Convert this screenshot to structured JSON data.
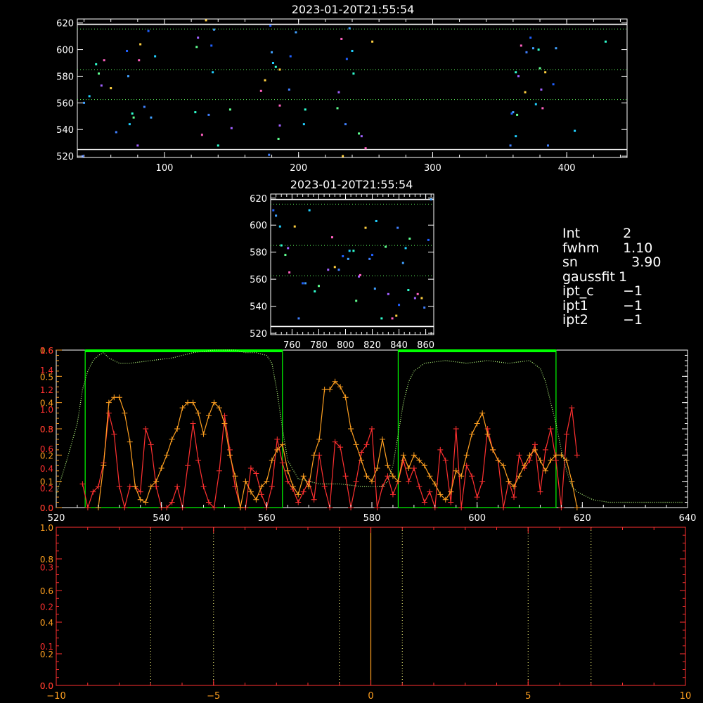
{
  "chart_data": [
    {
      "type": "scatter",
      "title": "2023-01-20T21:55:54",
      "xlim": [
        35,
        445
      ],
      "ylim": [
        519,
        623
      ],
      "xticks": [
        100,
        200,
        300,
        400
      ],
      "yticks": [
        520,
        540,
        560,
        580,
        600,
        620
      ],
      "hlines_solid": [
        525,
        619
      ],
      "hlines_dotted": [
        562.5,
        585,
        615.5
      ],
      "points": [
        [
          39,
          520
        ],
        [
          40,
          560
        ],
        [
          44,
          565
        ],
        [
          49,
          589
        ],
        [
          51,
          582
        ],
        [
          53,
          573
        ],
        [
          55,
          592
        ],
        [
          60,
          571
        ],
        [
          64,
          538
        ],
        [
          72,
          599
        ],
        [
          73,
          580
        ],
        [
          74,
          544
        ],
        [
          76,
          552
        ],
        [
          77,
          549
        ],
        [
          80,
          528
        ],
        [
          81,
          592
        ],
        [
          82,
          604
        ],
        [
          85,
          557
        ],
        [
          88,
          614
        ],
        [
          90,
          549
        ],
        [
          93,
          595
        ],
        [
          123,
          553
        ],
        [
          124,
          602
        ],
        [
          125,
          609
        ],
        [
          128,
          536
        ],
        [
          131,
          622
        ],
        [
          133,
          551
        ],
        [
          135,
          603
        ],
        [
          137,
          615
        ],
        [
          136,
          583
        ],
        [
          140,
          528
        ],
        [
          149,
          555
        ],
        [
          150,
          541
        ],
        [
          172,
          569
        ],
        [
          175,
          577
        ],
        [
          178,
          521
        ],
        [
          179,
          618
        ],
        [
          180,
          598
        ],
        [
          181,
          590
        ],
        [
          183,
          587
        ],
        [
          185,
          533
        ],
        [
          186,
          543
        ],
        [
          186,
          558
        ],
        [
          186,
          585
        ],
        [
          193,
          570
        ],
        [
          194,
          595
        ],
        [
          198,
          613
        ],
        [
          204,
          544
        ],
        [
          205,
          555
        ],
        [
          229,
          556
        ],
        [
          230,
          568
        ],
        [
          232,
          608
        ],
        [
          233,
          520
        ],
        [
          235,
          544
        ],
        [
          236,
          593
        ],
        [
          238,
          616
        ],
        [
          240,
          599
        ],
        [
          241,
          582
        ],
        [
          245,
          537
        ],
        [
          247,
          535
        ],
        [
          250,
          526
        ],
        [
          255,
          606
        ],
        [
          358,
          528
        ],
        [
          359,
          552
        ],
        [
          360,
          553
        ],
        [
          362,
          535
        ],
        [
          362,
          583
        ],
        [
          363,
          551
        ],
        [
          364,
          580
        ],
        [
          366,
          603
        ],
        [
          369,
          568
        ],
        [
          370,
          598
        ],
        [
          373,
          609
        ],
        [
          375,
          601
        ],
        [
          377,
          559
        ],
        [
          379,
          600
        ],
        [
          380,
          586
        ],
        [
          381,
          570
        ],
        [
          382,
          556
        ],
        [
          384,
          583
        ],
        [
          386,
          528
        ],
        [
          390,
          574
        ],
        [
          392,
          601
        ],
        [
          406,
          539
        ],
        [
          429,
          606
        ]
      ]
    },
    {
      "type": "scatter",
      "title": "2023-01-20T21:55:54",
      "xlim": [
        744,
        866
      ],
      "ylim": [
        519,
        623
      ],
      "xticks": [
        760,
        780,
        800,
        820,
        840,
        860
      ],
      "yticks": [
        520,
        540,
        560,
        580,
        600,
        620
      ],
      "hlines_solid": [
        525,
        619
      ],
      "hlines_dotted": [
        562.5,
        585,
        615.5
      ],
      "points": [
        [
          746,
          611
        ],
        [
          748,
          607
        ],
        [
          751,
          599
        ],
        [
          752,
          585
        ],
        [
          755,
          578
        ],
        [
          757,
          583
        ],
        [
          758,
          565
        ],
        [
          762,
          599
        ],
        [
          765,
          531
        ],
        [
          768,
          557
        ],
        [
          770,
          557
        ],
        [
          773,
          611
        ],
        [
          777,
          551
        ],
        [
          780,
          555
        ],
        [
          787,
          567
        ],
        [
          790,
          591
        ],
        [
          792,
          569
        ],
        [
          795,
          567
        ],
        [
          798,
          577
        ],
        [
          802,
          575
        ],
        [
          803,
          581
        ],
        [
          806,
          581
        ],
        [
          808,
          544
        ],
        [
          810,
          562
        ],
        [
          811,
          563
        ],
        [
          815,
          598
        ],
        [
          818,
          575
        ],
        [
          820,
          578
        ],
        [
          822,
          553
        ],
        [
          823,
          603
        ],
        [
          827,
          531
        ],
        [
          830,
          584
        ],
        [
          832,
          549
        ],
        [
          835,
          531
        ],
        [
          838,
          533
        ],
        [
          839,
          598
        ],
        [
          840,
          541
        ],
        [
          843,
          572
        ],
        [
          845,
          583
        ],
        [
          847,
          552
        ],
        [
          848,
          590
        ],
        [
          852,
          546
        ],
        [
          854,
          549
        ],
        [
          857,
          546
        ],
        [
          859,
          539
        ],
        [
          862,
          589
        ],
        [
          864,
          619
        ]
      ]
    },
    {
      "type": "line",
      "xlim": [
        520,
        640
      ],
      "ylim_left": [
        0,
        0.6
      ],
      "ylim_right": [
        0,
        0.6
      ],
      "xticks": [
        520,
        540,
        560,
        580,
        600,
        620,
        640
      ],
      "yticks_left_orange": [
        0.0,
        0.1,
        0.2,
        0.3,
        0.4,
        0.5,
        0.6
      ],
      "yticks_left_red": [
        0.0,
        0.2,
        0.4,
        0.6,
        0.8,
        1.0,
        1.2,
        1.4,
        1.6
      ],
      "green_boxes": [
        [
          525.5,
          563
        ],
        [
          585,
          615
        ]
      ],
      "series": [
        {
          "color": "#ff3030",
          "x": [
            525,
            526,
            527,
            528,
            529,
            530,
            531,
            532,
            533,
            534,
            535,
            536,
            537,
            538,
            539,
            540,
            541,
            542,
            543,
            544,
            545,
            546,
            547,
            548,
            549,
            550,
            551,
            552,
            553,
            554,
            555,
            556,
            557,
            558,
            559,
            560,
            561,
            562,
            563,
            564,
            565,
            566,
            567,
            568,
            569,
            570,
            571,
            572,
            573,
            574,
            575,
            576,
            577,
            578,
            579,
            580,
            581,
            582,
            583,
            584,
            585,
            586,
            587,
            588,
            589,
            590,
            591,
            592,
            593,
            594,
            595,
            596,
            597,
            598,
            599,
            600,
            601,
            602,
            603,
            604,
            605,
            606,
            607,
            608,
            609,
            610,
            611,
            612,
            613,
            614,
            615,
            616,
            617,
            618,
            619
          ],
          "y": [
            0.09,
            0.0,
            0.06,
            0.08,
            0.17,
            0.36,
            0.28,
            0.08,
            0.0,
            0.08,
            0.08,
            0.06,
            0.3,
            0.24,
            0.08,
            0.0,
            0.0,
            0.02,
            0.08,
            0.0,
            0.16,
            0.32,
            0.18,
            0.08,
            0.02,
            0.0,
            0.14,
            0.35,
            0.22,
            0.08,
            0.0,
            0.0,
            0.15,
            0.13,
            0.05,
            0.0,
            0.08,
            0.26,
            0.17,
            0.1,
            0.07,
            0.02,
            0.06,
            0.1,
            0.03,
            0.2,
            0.08,
            0.0,
            0.25,
            0.23,
            0.12,
            0.0,
            0.1,
            0.21,
            0.24,
            0.3,
            0.0,
            0.08,
            0.12,
            0.05,
            0.1,
            0.18,
            0.1,
            0.15,
            0.08,
            0.02,
            0.06,
            0.0,
            0.22,
            0.18,
            0.02,
            0.3,
            0.0,
            0.16,
            0.12,
            0.04,
            0.1,
            0.3,
            0.22,
            0.18,
            0.0,
            0.1,
            0.04,
            0.2,
            0.15,
            0.18,
            0.24,
            0.06,
            0.22,
            0.3,
            0.18,
            0.0,
            0.28,
            0.38,
            0.2
          ]
        },
        {
          "color": "#ffa020",
          "x": [
            528,
            529,
            530,
            531,
            532,
            533,
            534,
            535,
            536,
            537,
            538,
            539,
            540,
            541,
            542,
            543,
            544,
            545,
            546,
            547,
            548,
            549,
            550,
            551,
            552,
            553,
            554,
            555,
            556,
            557,
            558,
            559,
            560,
            561,
            562,
            563,
            564,
            565,
            566,
            567,
            568,
            569,
            570,
            571,
            572,
            573,
            574,
            575,
            576,
            577,
            578,
            579,
            580,
            581,
            582,
            583,
            584,
            585,
            586,
            587,
            588,
            589,
            590,
            591,
            592,
            593,
            594,
            595,
            596,
            597,
            598,
            599,
            600,
            601,
            602,
            603,
            604,
            605,
            606,
            607,
            608,
            609,
            610,
            611,
            612,
            613,
            614,
            615,
            616,
            617,
            618,
            619
          ],
          "y": [
            0.0,
            0.16,
            0.4,
            0.42,
            0.42,
            0.36,
            0.25,
            0.08,
            0.03,
            0.02,
            0.08,
            0.1,
            0.15,
            0.2,
            0.26,
            0.3,
            0.38,
            0.4,
            0.4,
            0.36,
            0.28,
            0.35,
            0.4,
            0.38,
            0.32,
            0.2,
            0.12,
            0.0,
            0.1,
            0.06,
            0.03,
            0.08,
            0.1,
            0.18,
            0.22,
            0.24,
            0.14,
            0.08,
            0.05,
            0.12,
            0.08,
            0.2,
            0.26,
            0.45,
            0.45,
            0.48,
            0.46,
            0.42,
            0.3,
            0.24,
            0.18,
            0.12,
            0.1,
            0.15,
            0.26,
            0.16,
            0.12,
            0.1,
            0.2,
            0.15,
            0.2,
            0.18,
            0.16,
            0.12,
            0.09,
            0.05,
            0.03,
            0.06,
            0.14,
            0.12,
            0.2,
            0.28,
            0.32,
            0.36,
            0.28,
            0.22,
            0.18,
            0.16,
            0.1,
            0.08,
            0.12,
            0.16,
            0.2,
            0.22,
            0.18,
            0.14,
            0.18,
            0.2,
            0.2,
            0.18,
            0.1,
            0.0
          ]
        },
        {
          "color": "#b8ff80",
          "style": "dotted",
          "x": [
            520,
            522,
            524,
            525,
            526,
            527,
            528,
            529,
            530,
            531,
            532,
            534,
            538,
            542,
            546,
            550,
            554,
            556,
            558,
            560,
            561,
            562,
            563,
            564,
            566,
            570,
            574,
            578,
            582,
            583,
            584,
            585,
            586,
            587,
            588,
            590,
            594,
            598,
            602,
            606,
            610,
            612,
            613,
            614,
            615,
            616,
            617,
            618,
            619,
            620,
            622,
            625,
            630,
            635,
            639
          ],
          "y": [
            0.05,
            0.18,
            0.32,
            0.45,
            0.52,
            0.56,
            0.58,
            0.59,
            0.57,
            0.56,
            0.55,
            0.55,
            0.56,
            0.57,
            0.59,
            0.6,
            0.6,
            0.59,
            0.59,
            0.58,
            0.55,
            0.44,
            0.3,
            0.18,
            0.11,
            0.09,
            0.09,
            0.08,
            0.08,
            0.1,
            0.16,
            0.28,
            0.4,
            0.48,
            0.52,
            0.55,
            0.56,
            0.55,
            0.56,
            0.55,
            0.56,
            0.53,
            0.48,
            0.4,
            0.32,
            0.22,
            0.14,
            0.08,
            0.06,
            0.05,
            0.03,
            0.02,
            0.02,
            0.02,
            0.02
          ]
        }
      ]
    },
    {
      "type": "line",
      "xlim": [
        -10,
        10
      ],
      "ylim": [
        0,
        1.0
      ],
      "xticks": [
        -10,
        -5,
        0,
        5,
        10
      ],
      "yticks_left_orange": [
        0.0,
        0.2,
        0.4,
        0.6,
        0.8,
        1.0
      ],
      "yticks_left_red": [
        0.0,
        0.1,
        0.2,
        0.3
      ],
      "vlines_dotted": [
        -7,
        -5,
        -1,
        1,
        5,
        7
      ],
      "vline_solid": 0
    }
  ],
  "info": {
    "rows": [
      {
        "key": "Int",
        "value": "  2"
      },
      {
        "key": "fwhm",
        "value": "  1.10"
      },
      {
        "key": "sn",
        "value": "    3.90"
      },
      {
        "key": "gaussfit",
        "value": " 1"
      },
      {
        "key": "ipt_c",
        "value": "  −1"
      },
      {
        "key": "ipt1",
        "value": "  −1"
      },
      {
        "key": "ipt2",
        "value": "  −1"
      }
    ]
  },
  "colors": {
    "bg": "#000000",
    "axis": "#ffffff",
    "orange": "#ffa020",
    "red": "#ff3030",
    "green": "#00ff00",
    "dotted_green": "#b8ff80",
    "yellow_dotted": "#ffff80"
  }
}
